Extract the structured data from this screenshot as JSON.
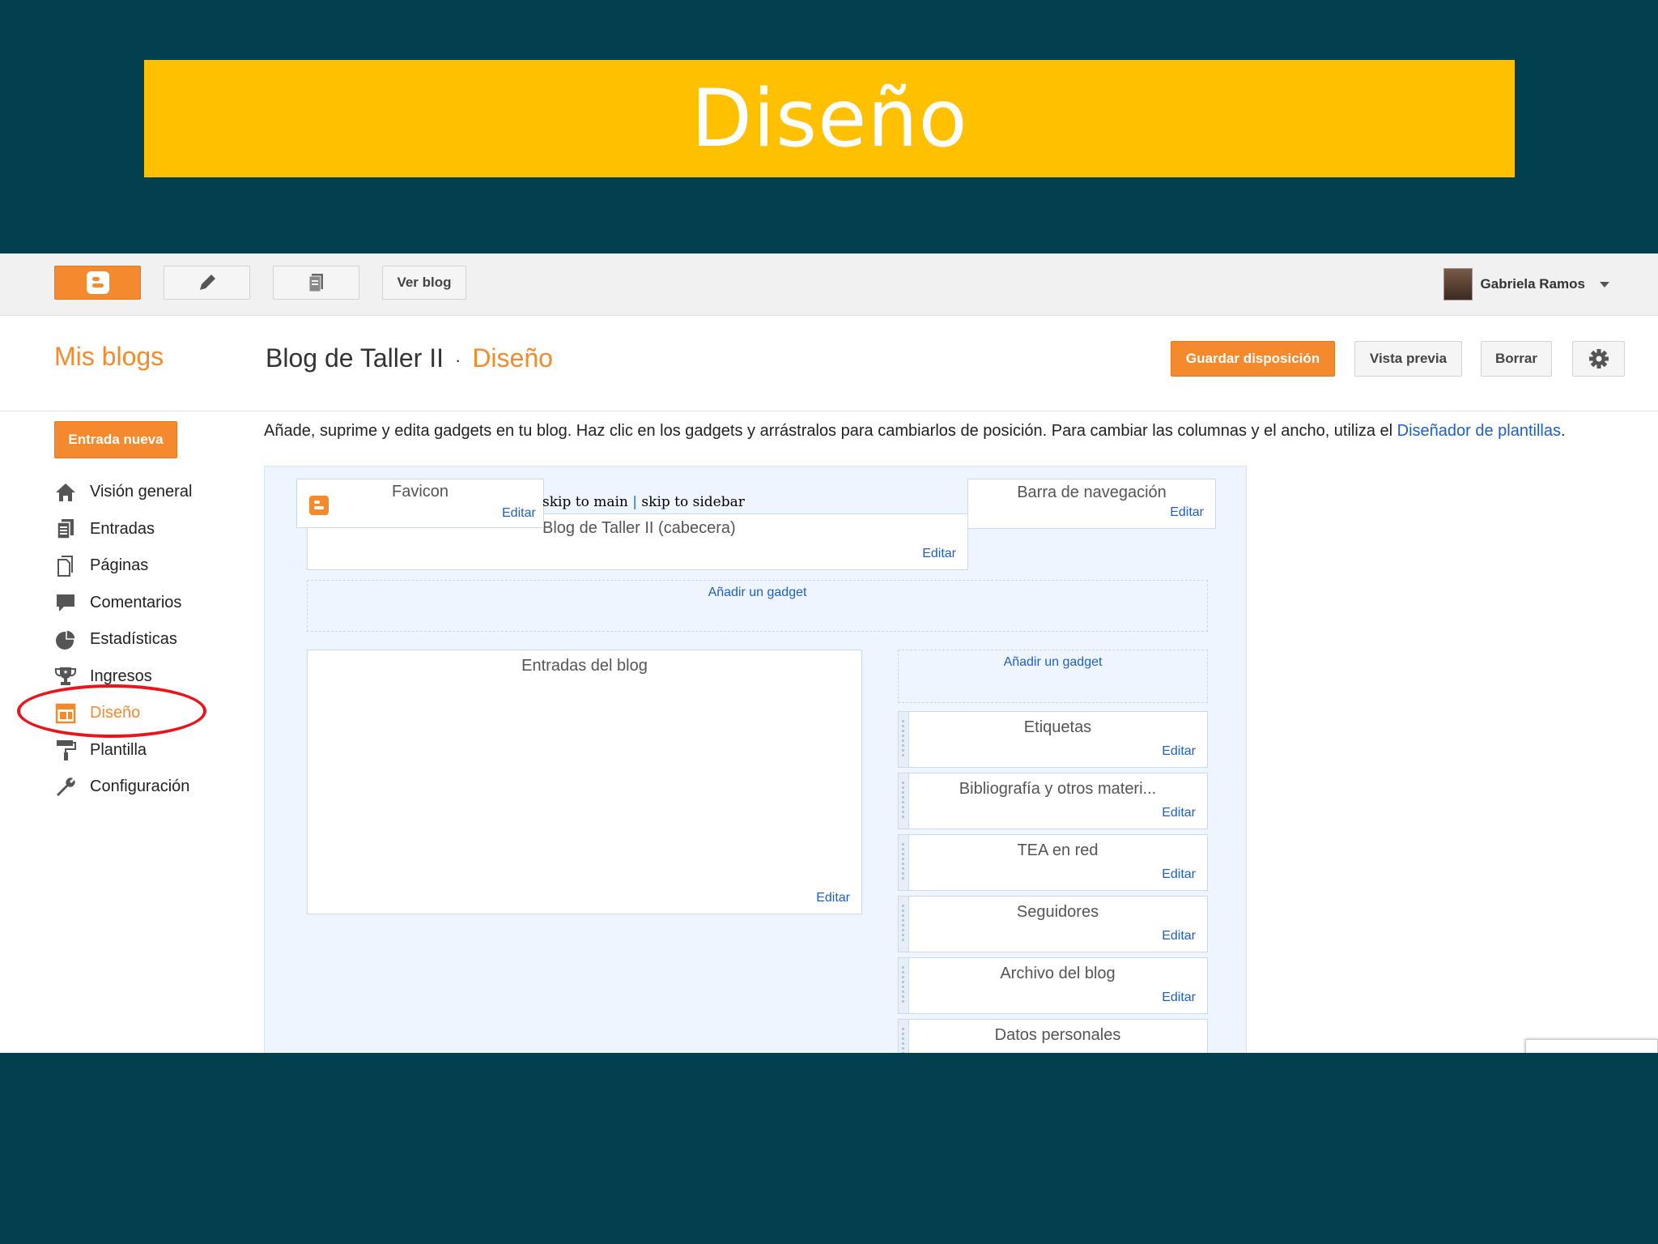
{
  "slide": {
    "title": "Diseño"
  },
  "topbar": {
    "blogger_icon": "blogger-logo-icon",
    "new_post_icon": "pencil-icon",
    "posts_icon": "pages-icon",
    "view_blog": "Ver blog",
    "user_name": "Gabriela Ramos"
  },
  "header": {
    "my_blogs": "Mis blogs",
    "blog_name": "Blog de Taller II",
    "separator": "·",
    "current_section": "Diseño",
    "save_layout": "Guardar disposición",
    "preview": "Vista previa",
    "clear": "Borrar"
  },
  "sidebar": {
    "new_post": "Entrada nueva",
    "items": [
      {
        "label": "Visión general",
        "icon": "home-icon"
      },
      {
        "label": "Entradas",
        "icon": "posts-icon"
      },
      {
        "label": "Páginas",
        "icon": "pages-icon"
      },
      {
        "label": "Comentarios",
        "icon": "comment-icon"
      },
      {
        "label": "Estadísticas",
        "icon": "pie-chart-icon"
      },
      {
        "label": "Ingresos",
        "icon": "trophy-icon"
      },
      {
        "label": "Diseño",
        "icon": "layout-icon",
        "active": true
      },
      {
        "label": "Plantilla",
        "icon": "paint-roller-icon"
      },
      {
        "label": "Configuración",
        "icon": "wrench-icon"
      }
    ]
  },
  "main": {
    "description": "Añade, suprime y edita gadgets en tu blog. Haz clic en los gadgets y arrástralos para cambiarlos de posición. Para cambiar las columnas y el ancho, utiliza el ",
    "description_link": "Diseñador de plantillas",
    "description_end": "."
  },
  "layout": {
    "edit_label": "Editar",
    "add_gadget": "Añadir un gadget",
    "favicon": "Favicon",
    "skip_main": "skip to main",
    "skip_sep": "|",
    "skip_sidebar": "skip to sidebar",
    "header_gadget": "Blog de Taller II (cabecera)",
    "navbar": "Barra de navegación",
    "posts": "Entradas del blog",
    "sidebar_gadgets": [
      "Etiquetas",
      "Bibliografía y otros materi...",
      "TEA en red",
      "Seguidores",
      "Archivo del blog",
      "Datos personales"
    ]
  },
  "colors": {
    "accent": "#f48a2d",
    "link": "#1f5fc4",
    "slide_bg": "#02404f",
    "title_bar": "#ffc000",
    "highlight": "#e8151b"
  }
}
